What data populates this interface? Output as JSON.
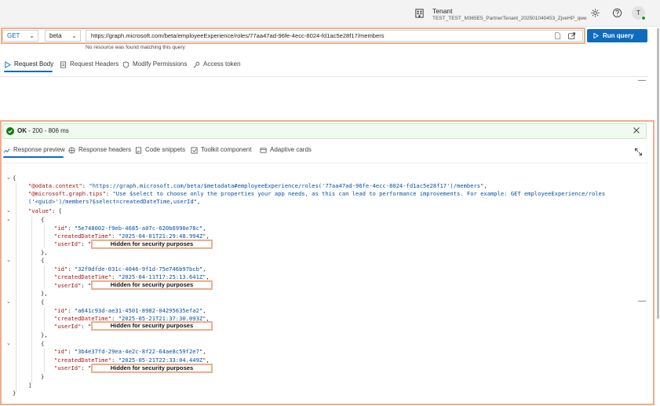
{
  "header": {
    "tenant_label": "Tenant",
    "tenant_name": "TEST_TEST_M365E5_PartnerTenant_202501040453_ZjveHP_qwe",
    "avatar_initial": "T"
  },
  "query": {
    "method": "GET",
    "version": "beta",
    "url": "https://graph.microsoft.com/beta/employeeExperience/roles/77aa47ad-96fe-4ecc-8024-fd1ac5e28f17/members",
    "run_label": "Run query",
    "hint": "No resource was found matching this query"
  },
  "request_tabs": [
    {
      "label": "Request Body",
      "icon": "play-outline-icon"
    },
    {
      "label": "Request Headers",
      "icon": "document-icon"
    },
    {
      "label": "Modify Permissions",
      "icon": "shield-icon"
    },
    {
      "label": "Access token",
      "icon": "key-icon"
    }
  ],
  "status": {
    "ok": "OK",
    "detail": " - 200 - 806 ms",
    "color": "#107c10"
  },
  "response_tabs": [
    {
      "label": "Response preview",
      "icon": "preview-icon"
    },
    {
      "label": "Response headers",
      "icon": "headers-icon"
    },
    {
      "label": "Code snippets",
      "icon": "code-icon"
    },
    {
      "label": "Toolkit component",
      "icon": "toolkit-icon"
    },
    {
      "label": "Adaptive cards",
      "icon": "cards-icon"
    }
  ],
  "response": {
    "odata_context_key": "\"@odata.context\"",
    "odata_context_value": "\"https://graph.microsoft.com/beta/$metadata#employeeExperience/roles('77aa47ad-96fe-4ecc-8024-fd1ac5e28f17')/members\"",
    "tips_key": "\"@microsoft.graph.tips\"",
    "tips_value_1": "\"Use $select to choose only the properties your app needs, as this can lead to performance improvements. For example: GET employeeExperience/roles",
    "tips_value_2": "('<guid>')/members?$select=createdDateTime,userId\"",
    "value_key": "\"value\"",
    "id_key": "\"id\"",
    "created_key": "\"createdDateTime\"",
    "user_key": "\"userId\"",
    "items": [
      {
        "id": "\"5e748002-f9eb-4685-a07c-620b6990e78c\"",
        "createdDateTime": "\"2025-04-01T21:29:48.994Z\"",
        "userId": "Hidden for security purposes"
      },
      {
        "id": "\"32f0dfde-031c-4046-9f1d-75e746b97bcb\"",
        "createdDateTime": "\"2025-04-11T17:25:13.641Z\"",
        "userId": "Hidden for security purposes"
      },
      {
        "id": "\"a641c93d-ae31-4501-8982-04295635efa2\"",
        "createdDateTime": "\"2025-05-21T21:37:30.093Z\"",
        "userId": "Hidden for security purposes"
      },
      {
        "id": "\"3b4e37fd-29ea-4e2c-8f22-64ae8c59f2e7\"",
        "createdDateTime": "\"2025-05-21T22:33:04.449Z\"",
        "userId": "Hidden for security purposes"
      }
    ]
  }
}
